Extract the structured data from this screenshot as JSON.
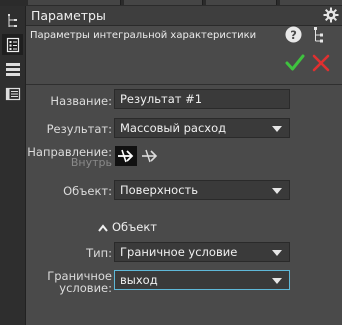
{
  "panel": {
    "title": "Параметры",
    "subtitle": "Параметры интегральной характеристики"
  },
  "toolbar": {
    "items": [
      {
        "icon": "tree-icon"
      },
      {
        "icon": "properties-icon",
        "active": true
      },
      {
        "icon": "layers-icon"
      },
      {
        "icon": "list-icon"
      }
    ]
  },
  "form": {
    "name_label": "Название:",
    "name_value": "Результат #1",
    "result_label": "Результат:",
    "result_value": "Массовый расход",
    "direction_label": "Направление:",
    "direction_sublabel": "Внутрь",
    "object_label": "Объект:",
    "object_value": "Поверхность"
  },
  "object_section": {
    "title": "Объект",
    "type_label": "Тип:",
    "type_value": "Граничное условие",
    "bc_label_line1": "Граничное",
    "bc_label_line2": "условие:",
    "bc_value": "выход"
  },
  "colors": {
    "accent_ok": "#3fc23f",
    "accent_cancel": "#e03030",
    "focus_border": "#5fb8d8"
  }
}
